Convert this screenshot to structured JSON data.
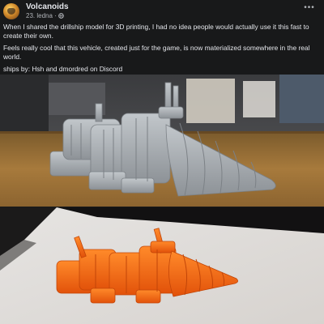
{
  "post": {
    "author": "Volcanoids",
    "date": "23. ledna",
    "separator": "·",
    "audience_icon": "globe-icon",
    "more_icon": "ellipsis-icon",
    "more_label": "•••",
    "paragraphs": [
      "When I shared the drillship model for 3D printing, I had no idea people would actually use it this fast to create their own.",
      "Feels really cool that this vehicle, created just for the game, is now materialized somewhere in the real world.",
      "ships by: Hsh and dmordred on Discord"
    ]
  },
  "colors": {
    "background": "#18191a",
    "text": "#e4e6eb",
    "secondary_text": "#b0b3b8",
    "grey_print": "#a9aeb2",
    "orange_print": "#ff6a0a"
  }
}
